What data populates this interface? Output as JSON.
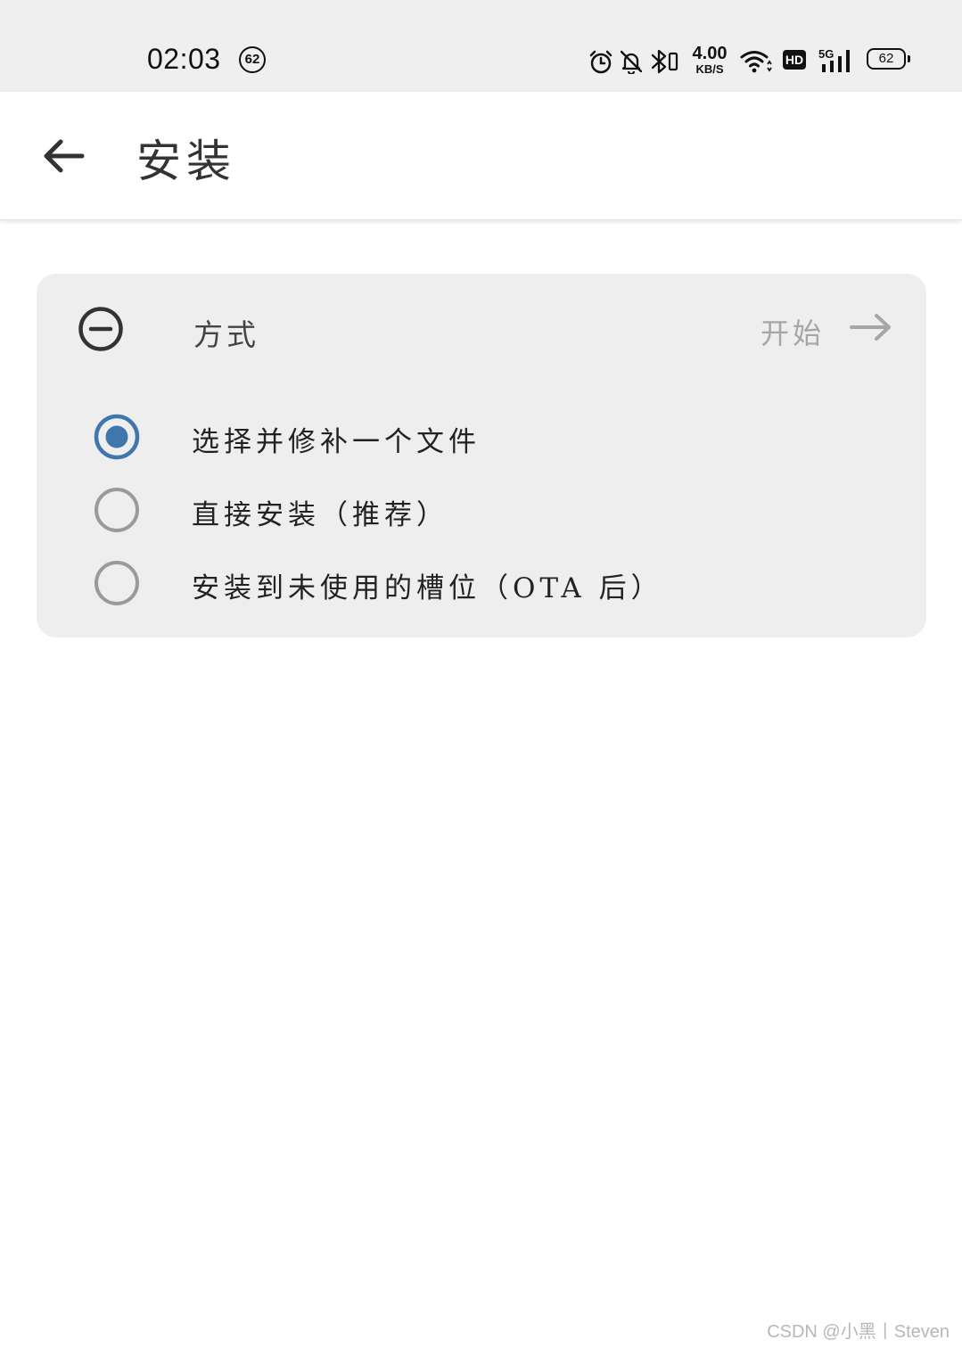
{
  "status_bar": {
    "time": "02:03",
    "notification_badge": "62",
    "net_speed_value": "4.00",
    "net_speed_unit": "KB/S",
    "hd_label": "HD",
    "signal_label": "5G",
    "battery_level": "62",
    "icons": [
      "alarm-icon",
      "bell-off-icon",
      "bluetooth-icon",
      "wifi-icon",
      "hd-icon",
      "signal-5g-icon",
      "battery-icon"
    ]
  },
  "app_bar": {
    "title": "安装",
    "back_icon": "arrow-left-icon"
  },
  "method_card": {
    "title": "方式",
    "header_icon": "minus-circle-icon",
    "start_label": "开始",
    "start_icon": "arrow-right-icon",
    "options": [
      {
        "label": "选择并修补一个文件",
        "selected": true
      },
      {
        "label": "直接安装（推荐）",
        "selected": false
      },
      {
        "label": "安装到未使用的槽位（OTA 后）",
        "selected": false
      }
    ]
  },
  "colors": {
    "accent": "#3f77ad",
    "radio_unselected": "#9a9a9a",
    "card_background": "#eeeeee",
    "status_bar_background": "#efefef",
    "start_disabled": "#a6a6a6"
  },
  "watermark": "CSDN @小黑丨Steven"
}
